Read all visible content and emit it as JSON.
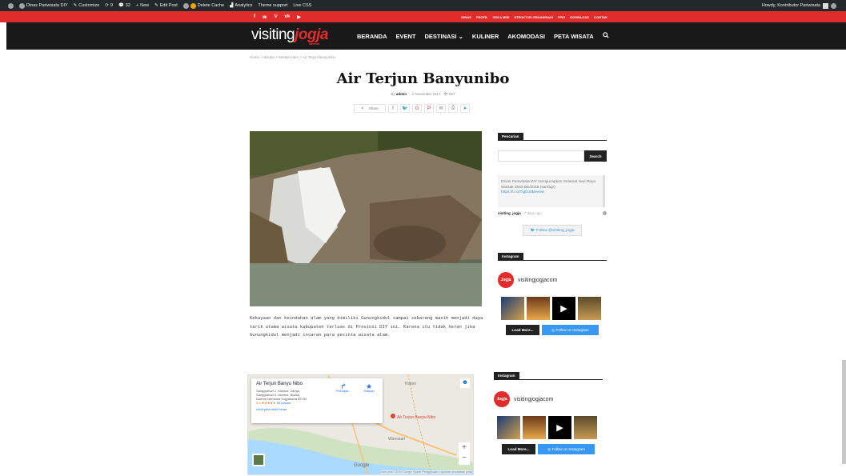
{
  "adminbar": {
    "items": [
      "Dinas Pariwisata DIY",
      "Customize",
      "9",
      "32",
      "New",
      "Edit Post",
      "Delete Cache",
      "Analytics",
      "Theme support",
      "Live CSS"
    ],
    "howdy": "Howdy, Kontributor Pariwisata"
  },
  "topbar": {
    "social": [
      "f",
      "𝕨",
      "V",
      "vk",
      "▶"
    ],
    "links": [
      "DINAS",
      "PROFIL",
      "VISI & MISI",
      "STRUKTUR ORGANISASI",
      "PPID",
      "DOWNLOAD",
      "KONTAK"
    ]
  },
  "nav": {
    "logo_main": "visiting",
    "logo_accent": "jogja",
    "logo_sub": "istimewa",
    "menu": [
      "BERANDA",
      "EVENT",
      "DESTINASI",
      "KULINER",
      "AKOMODASI",
      "PETA WISATA"
    ]
  },
  "breadcrumb": "Home  >  Wisata  >  Wisata Alam  >  Air Terjun Banyunibo",
  "post": {
    "title": "Air Terjun Banyunibo",
    "by": "By",
    "author": "admin",
    "date": "2 November 2017",
    "views": "827",
    "share_label": "Share",
    "intro": "Kekayaan dan keindahan alam yang dimiliki Gunungkidul sampai sekarang masih menjadi daya tarik utama wisata kabupaten terluas di Provinsi DIY ini. Karena itu tidak heran jika Gunungkidul menjadi incaran para pecinta wisata alam."
  },
  "map": {
    "place": "Air Terjun Banyu Nibo",
    "address1": "Sanggrahan 2, Muntuk, Dlingo,",
    "address2": "Sanggrahan II, Muntuk, Bantul,",
    "address3": "Daerah Istimewa Yogyakarta 55783",
    "rating": "4,4 ★★★★★",
    "reviews": "50 ulasan",
    "bigger": "Lihat peta lebih besar",
    "btn_dir": "Petunjuk...",
    "btn_save": "Simpan",
    "lbl_klaten": "Klaten",
    "lbl_pin": "Air Terjun Banyu Nibo",
    "lbl_wonosari": "Wonosari",
    "lbl_google": "Google",
    "footer": "Data peta ©2019 Google  Syarat Penggunaan  Laporkan kesalahan peta"
  },
  "sidebar": {
    "search_title": "Pencarian",
    "search_btn": "Search",
    "tweet": "Dinas Pariwisata DIY mengucapkan Selamat Hari Raya Waisak 2563 BE/2019 (san/agr)",
    "tweet_link": "https://t.co/TqjDJdBeeww",
    "tweet_user": "visiting_jogja",
    "tweet_ago": "· 7 days ago",
    "follow_tw": "Follow @visiting_jogja",
    "ig_title": "Instagram",
    "ig_user": "visitingjogjacom",
    "ig_avatar": "Jogja",
    "load_more": "Load More...",
    "follow_ig": "Follow on Instagram"
  }
}
